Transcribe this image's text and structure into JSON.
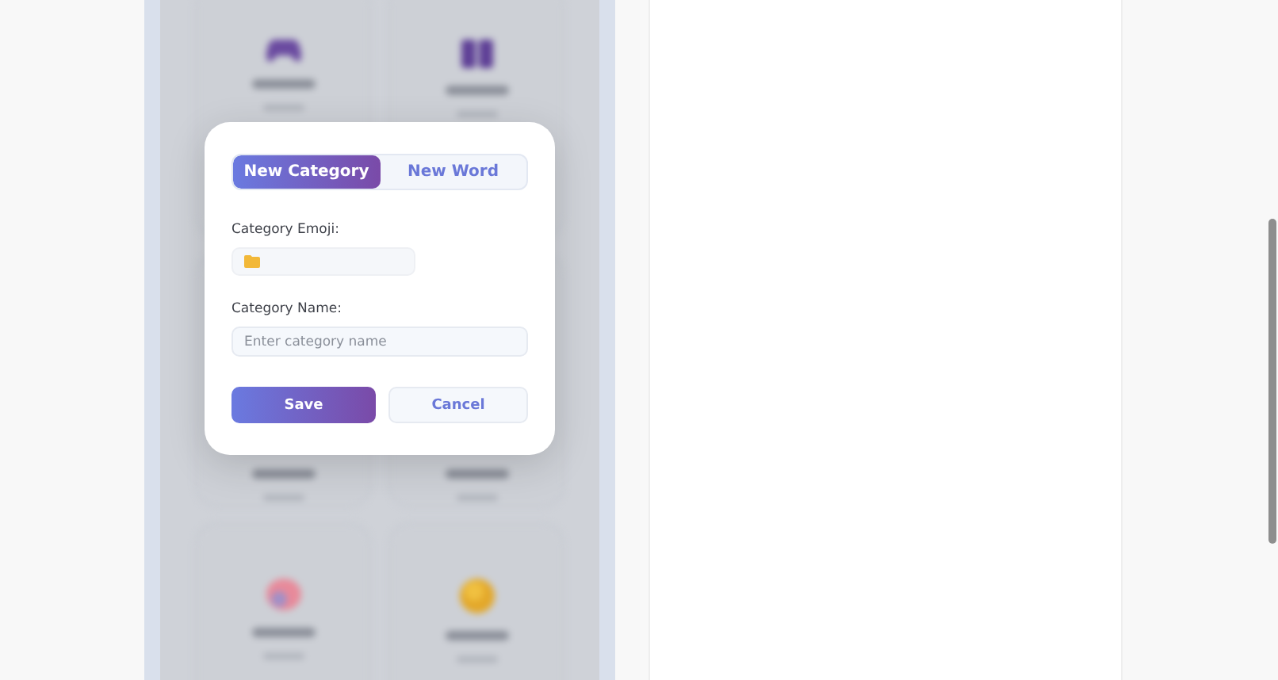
{
  "background_cards": [
    {
      "kind": "gamepad"
    },
    {
      "kind": "people"
    },
    {
      "kind": "covered"
    },
    {
      "kind": "covered"
    },
    {
      "kind": "brain"
    },
    {
      "kind": "sun"
    }
  ],
  "dialog": {
    "tabs": [
      {
        "label": "New Category",
        "selected": true
      },
      {
        "label": "New Word",
        "selected": false
      }
    ],
    "emoji_label": "Category Emoji:",
    "name_label": "Category Name:",
    "name_placeholder": "Enter category name",
    "buttons": [
      {
        "label": "Save",
        "kind": "primary"
      },
      {
        "label": "Cancel",
        "kind": "secondary"
      }
    ]
  }
}
